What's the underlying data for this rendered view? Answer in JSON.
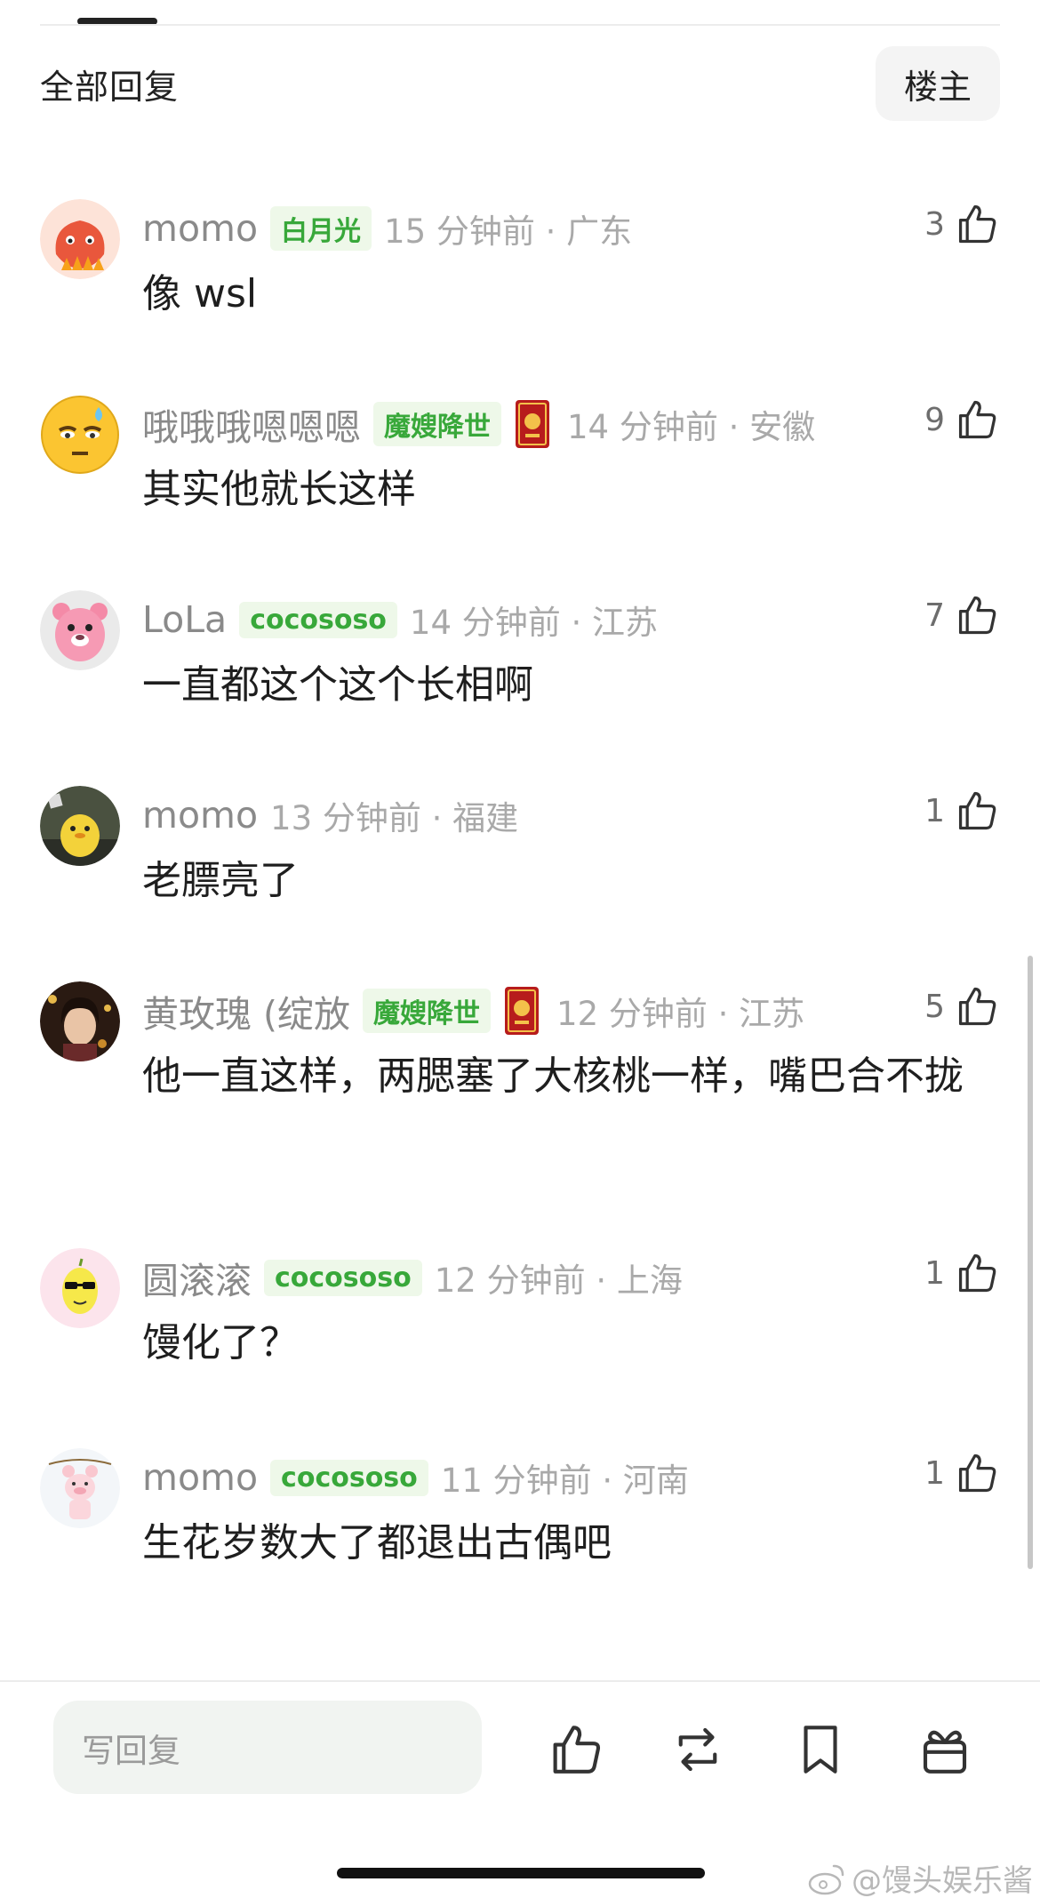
{
  "header": {
    "title": "全部回复",
    "op_button": "楼主"
  },
  "comments": [
    {
      "username": "momo",
      "badge": "白月光",
      "has_medal": false,
      "time_location": "15 分钟前 · 广东",
      "likes": "3",
      "content": "像 wsl",
      "avatar": "red-cartoon-avatar"
    },
    {
      "username": "哦哦哦嗯嗯嗯",
      "badge": "魔嫂降世",
      "has_medal": true,
      "time_location": "14 分钟前 · 安徽",
      "likes": "9",
      "content": "其实他就长这样",
      "avatar": "sweat-emoji-avatar"
    },
    {
      "username": "LoLa",
      "badge": "cocososo",
      "has_medal": false,
      "time_location": "14 分钟前 · 江苏",
      "likes": "7",
      "content": "一直都这个这个长相啊",
      "avatar": "pink-beaver-avatar"
    },
    {
      "username": "momo",
      "badge": "",
      "has_medal": false,
      "time_location": "13 分钟前 · 福建",
      "likes": "1",
      "content": "老膘亮了",
      "avatar": "yellow-duck-avatar"
    },
    {
      "username": "黄玫瑰 (绽放",
      "badge": "魔嫂降世",
      "has_medal": true,
      "time_location": "12 分钟前 · 江苏",
      "likes": "5",
      "content": "他一直这样，两腮塞了大核桃一样，嘴巴合不拢",
      "avatar": "portrait-photo-avatar"
    },
    {
      "username": "圆滚滚",
      "badge": "cocososo",
      "has_medal": false,
      "time_location": "12 分钟前 · 上海",
      "likes": "1",
      "content": "馒化了？",
      "avatar": "lemon-sunglasses-avatar"
    },
    {
      "username": "momo",
      "badge": "cocososo",
      "has_medal": false,
      "time_location": "11 分钟前 · 河南",
      "likes": "1",
      "content": "生花岁数大了都退出古偶吧",
      "avatar": "pig-cartoon-avatar"
    }
  ],
  "reply_box": {
    "placeholder": "写回复"
  },
  "toolbar": [
    "like-icon",
    "repost-icon",
    "bookmark-icon",
    "gift-icon"
  ],
  "watermark": "@馒头娱乐酱",
  "colors": {
    "badge_text": "#38a83a",
    "badge_bg": "#eef8e9",
    "meta_gray": "#a9a9a9",
    "username_gray": "#8a8a8a"
  }
}
